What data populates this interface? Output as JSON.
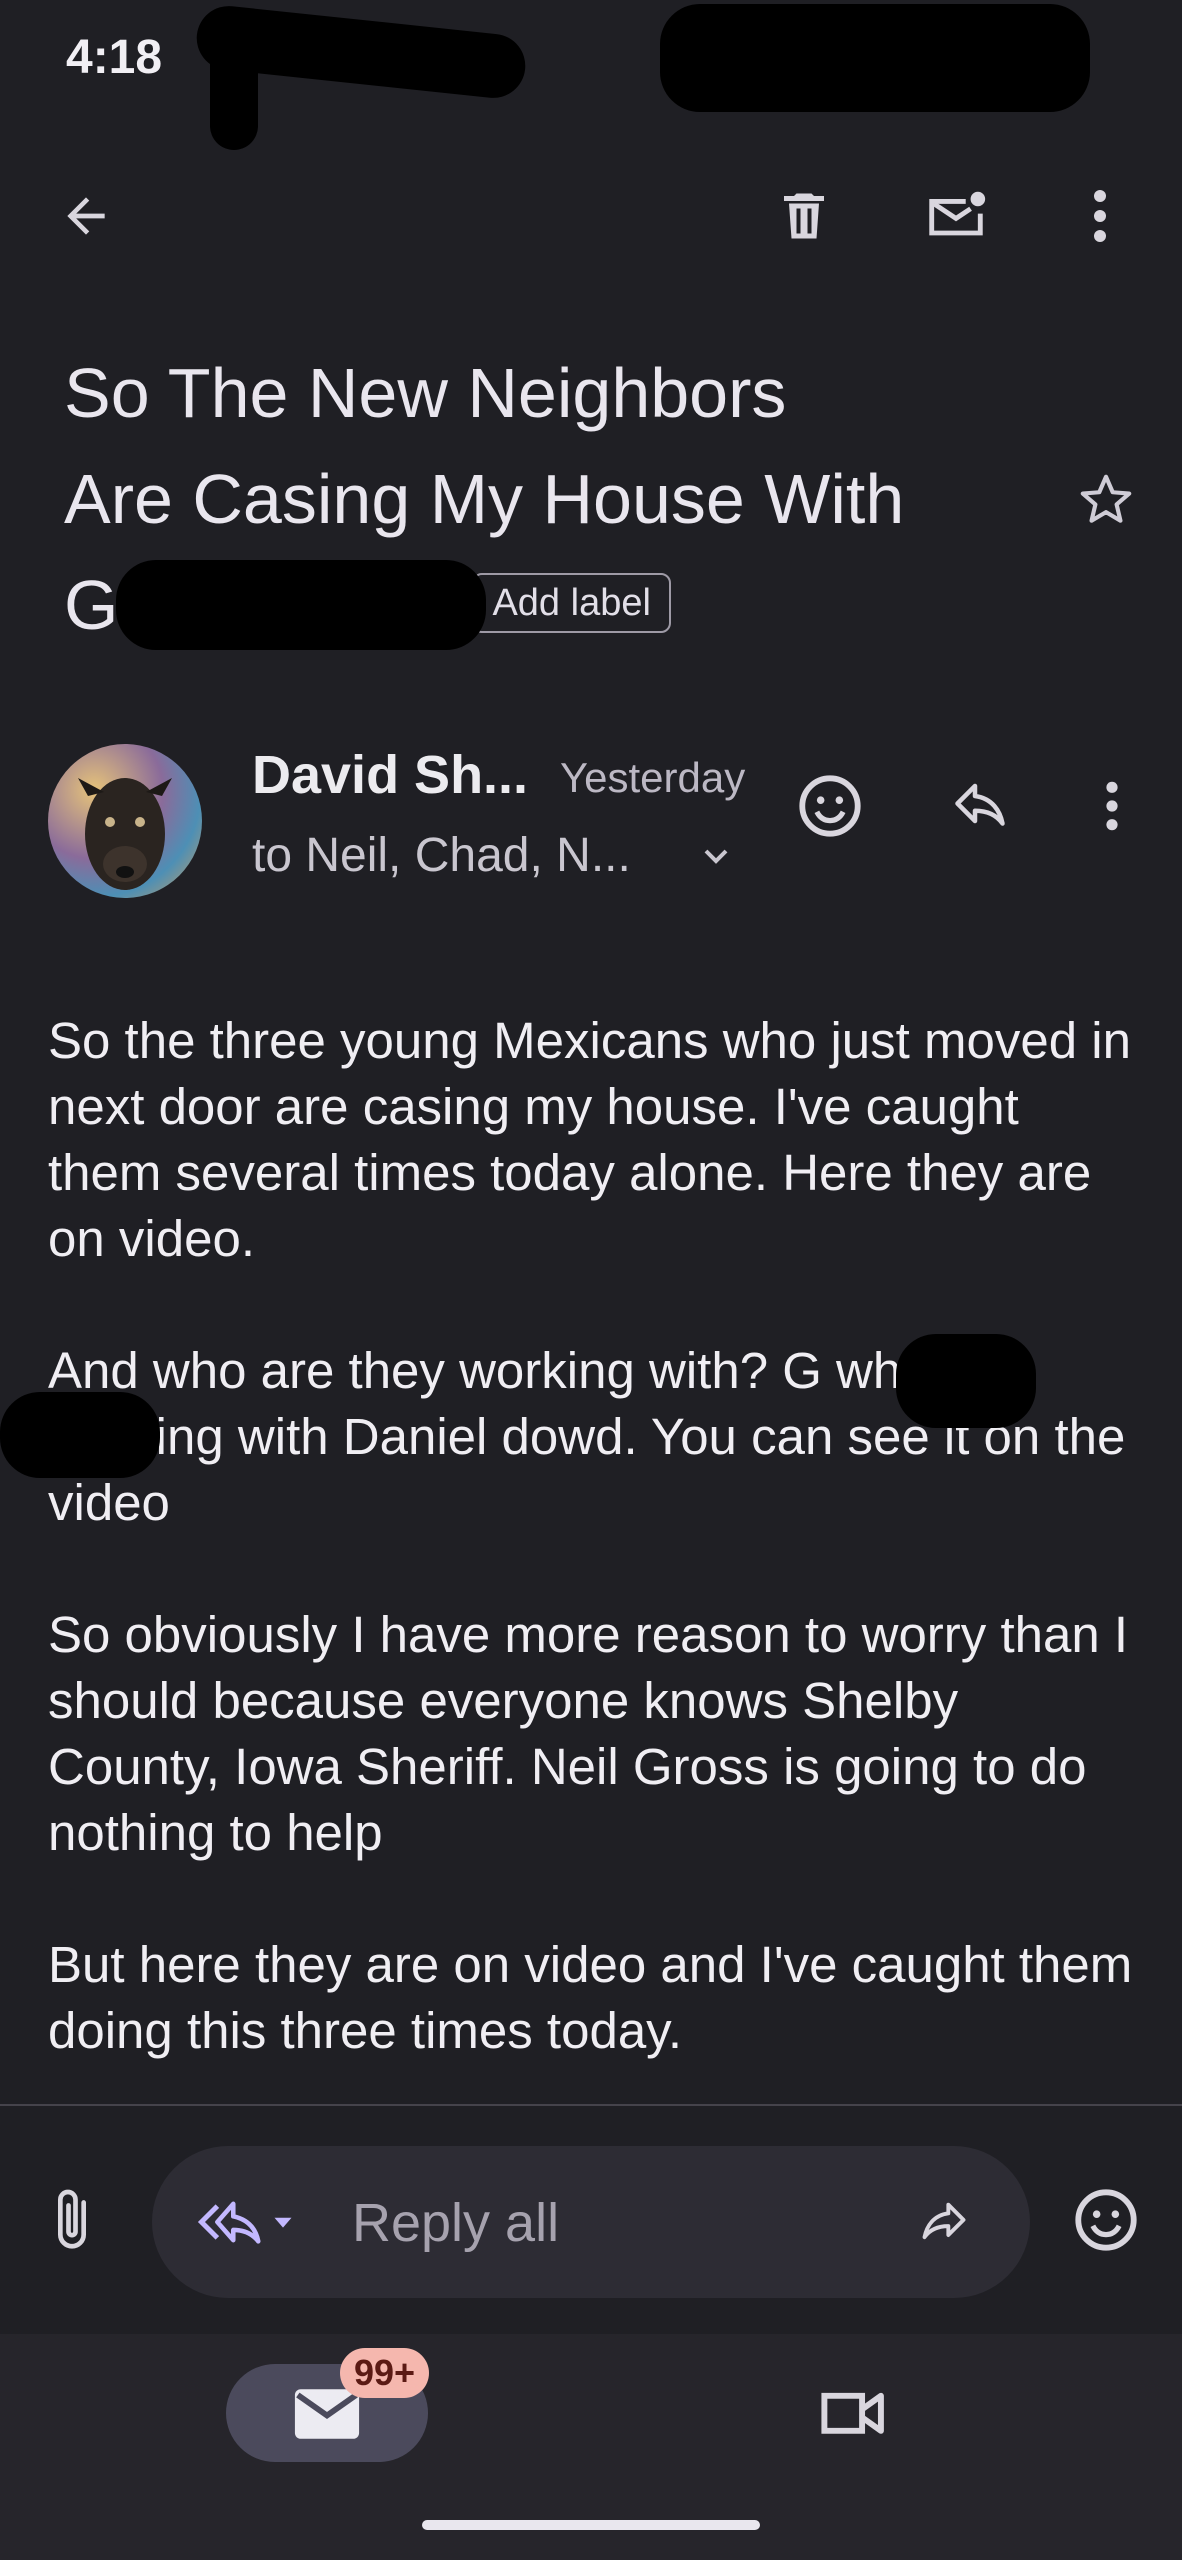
{
  "status_bar": {
    "time": "4:18"
  },
  "email": {
    "subject_lines": [
      "So The New Neighbors",
      "Are Casing My House With",
      "G"
    ],
    "label_chip": "Add label",
    "sender": {
      "name": "David Sh...",
      "time": "Yesterday",
      "recipients": "to Neil, Chad, N..."
    },
    "body": [
      "So the three young Mexicans who just moved in next door are casing my house. I've caught them several times today alone.  Here they are on video.",
      "And who are they working with? G who is working with Daniel dowd. You can see it on the video",
      "So obviously I have more reason to worry than I should because everyone knows Shelby County, Iowa Sheriff. Neil Gross is going to do nothing to help",
      "But here they are on video and I've caught them doing this three times today."
    ]
  },
  "reply": {
    "placeholder": "Reply all"
  },
  "bottom_nav": {
    "mail_badge": "99+"
  },
  "icons": [
    "back-arrow-icon",
    "trash-icon",
    "mark-unread-icon",
    "more-vert-icon",
    "star-icon",
    "emoji-icon",
    "reply-icon",
    "attach-icon",
    "reply-all-icon",
    "dropdown-icon",
    "forward-icon",
    "mail-icon",
    "video-icon"
  ],
  "colors": {
    "background": "#1f1f24",
    "text": "#e6e3ea",
    "accent": "#c3b8ff",
    "badge": "#f5b7ae"
  }
}
